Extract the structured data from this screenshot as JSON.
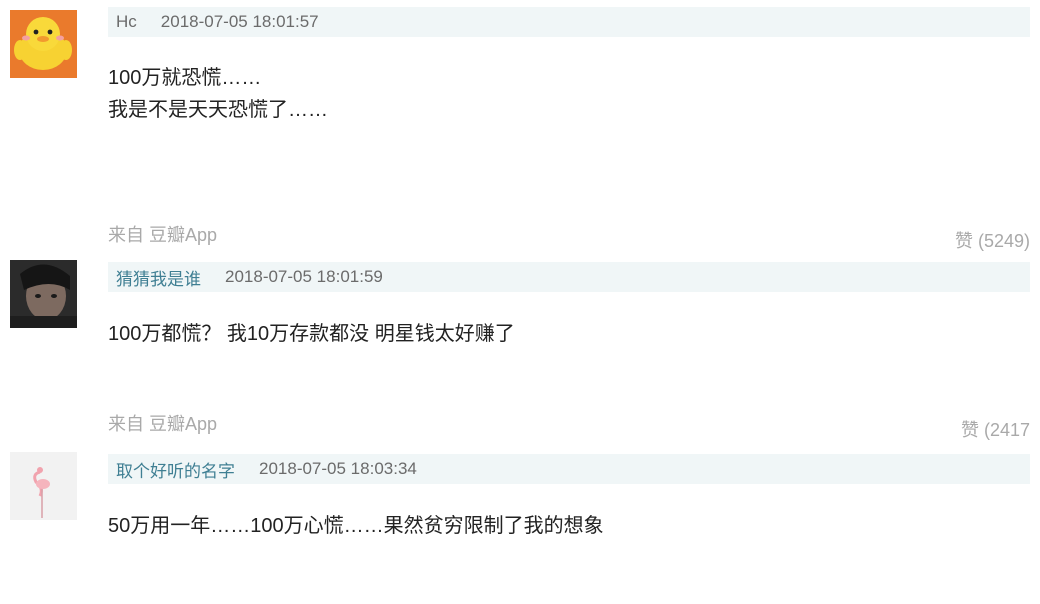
{
  "comments": [
    {
      "user": "Hc",
      "time": "2018-07-05 18:01:57",
      "lines": [
        "100万就恐慌……",
        "我是不是天天恐慌了……"
      ],
      "source": "来自 豆瓣App",
      "likes": "赞 (5249)"
    },
    {
      "user": "猜猜我是谁",
      "time": "2018-07-05 18:01:59",
      "lines": [
        "100万都慌？ 我10万存款都没 明星钱太好赚了"
      ],
      "source": "来自 豆瓣App",
      "likes": "赞 (2417"
    },
    {
      "user": "取个好听的名字",
      "time": "2018-07-05 18:03:34",
      "lines": [
        "50万用一年……100万心慌……果然贫穷限制了我的想象"
      ]
    }
  ]
}
